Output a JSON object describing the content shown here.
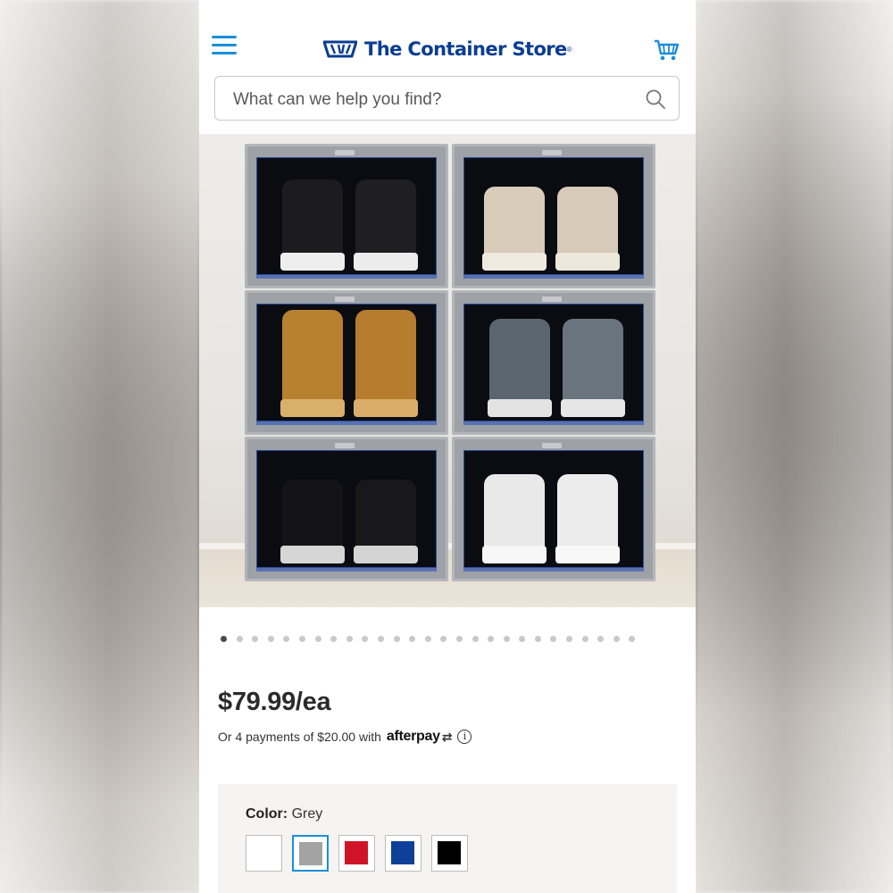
{
  "header": {
    "brand": "The Container Store",
    "brand_mark": "®",
    "menu_icon": "hamburger-menu-icon",
    "cart_icon": "shopping-cart-icon",
    "accent_color": "#1a8fd8",
    "brand_color": "#0b3d91"
  },
  "search": {
    "placeholder": "What can we help you find?",
    "value": "",
    "icon": "search-icon"
  },
  "gallery": {
    "image_count": 27,
    "active_index": 0
  },
  "product": {
    "price": "$79.99/ea",
    "installments_text": "Or 4 payments of $20.00 with",
    "installments_provider": "afterpay",
    "installments_provider_arrow": "⇄"
  },
  "color_picker": {
    "label": "Color:",
    "selected": "Grey",
    "options": [
      {
        "name": "White",
        "hex": "#ffffff"
      },
      {
        "name": "Grey",
        "hex": "#a3a3a3"
      },
      {
        "name": "Red",
        "hex": "#d01427"
      },
      {
        "name": "Blue",
        "hex": "#0f3f98"
      },
      {
        "name": "Black",
        "hex": "#000000"
      }
    ],
    "selected_index": 1
  }
}
